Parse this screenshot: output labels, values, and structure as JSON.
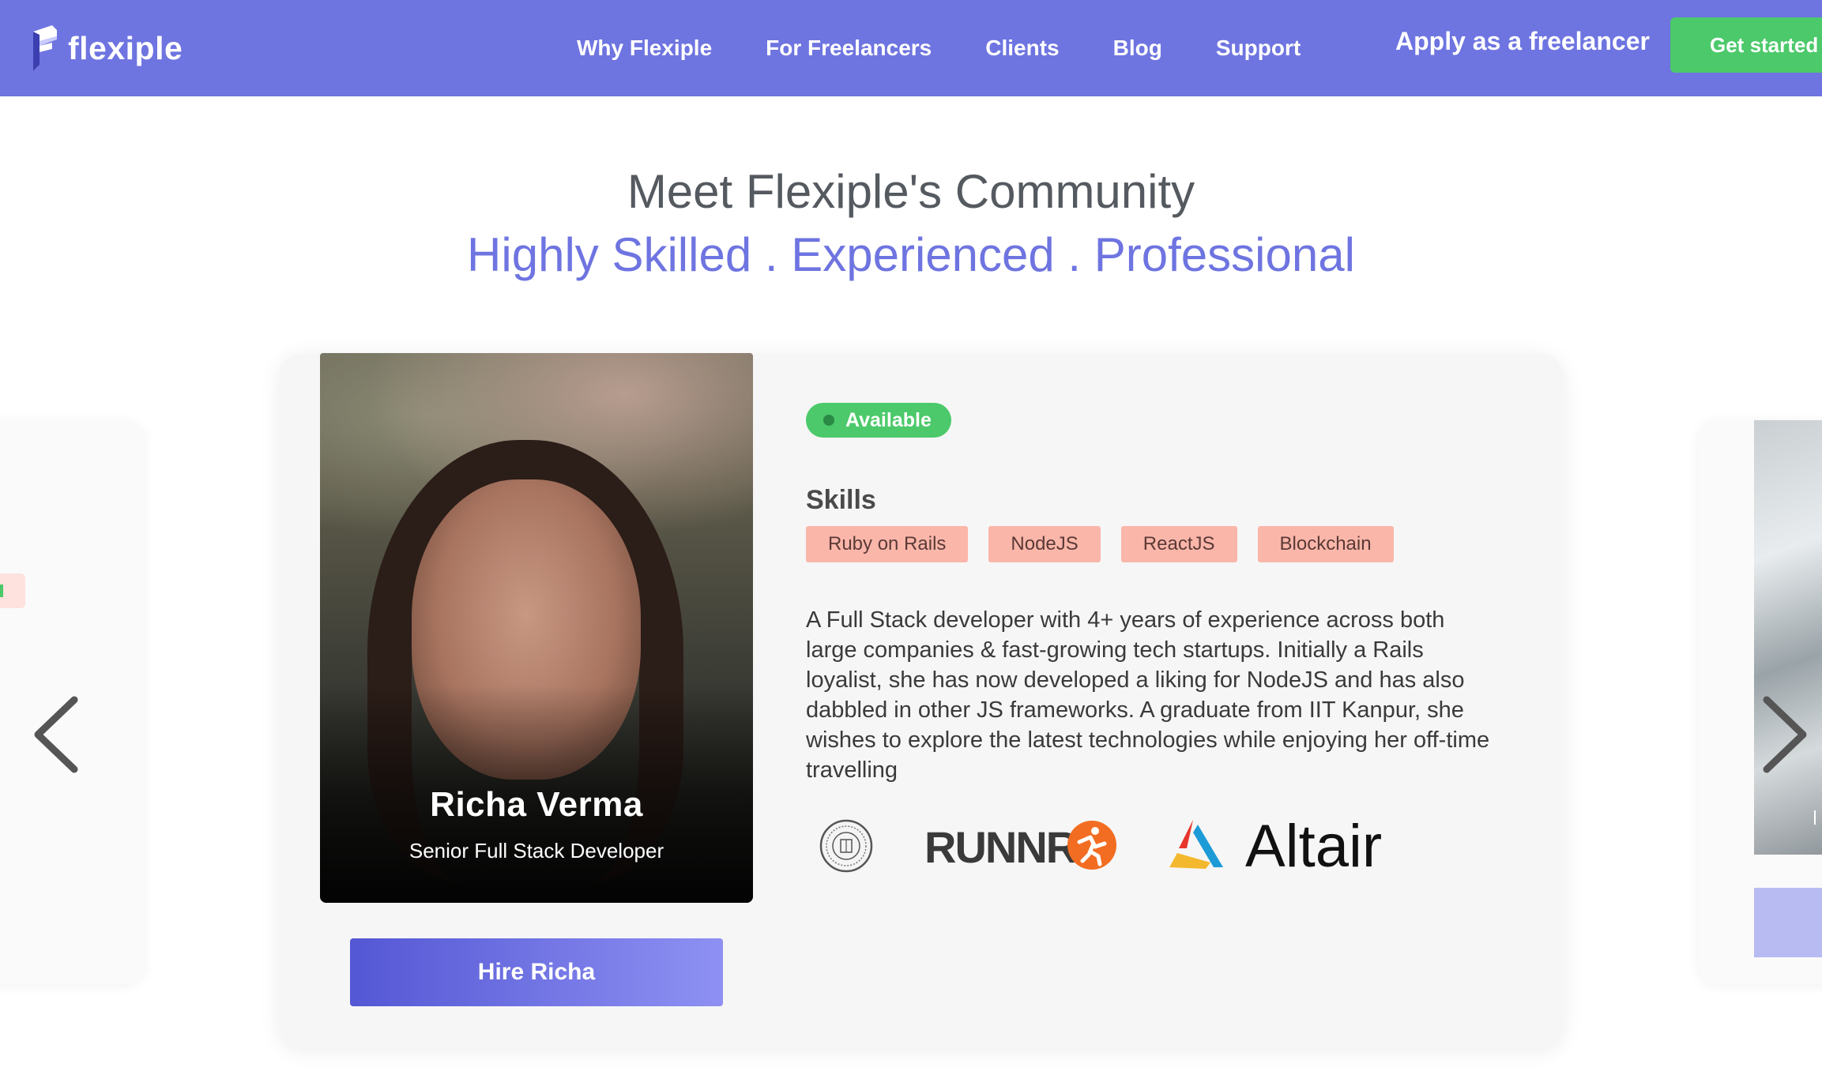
{
  "nav": {
    "brand": "flexiple",
    "links": [
      "Why Flexiple",
      "For Freelancers",
      "Clients",
      "Blog",
      "Support"
    ],
    "apply": "Apply as a freelancer",
    "cta": "Get started"
  },
  "hero": {
    "title": "Meet Flexiple's Community",
    "subtitle": "Highly Skilled . Experienced . Professional"
  },
  "profile": {
    "name": "Richa Verma",
    "role": "Senior Full Stack Developer",
    "status": "Available",
    "skills_title": "Skills",
    "skills": [
      "Ruby on Rails",
      "NodeJS",
      "ReactJS",
      "Blockchain"
    ],
    "bio": "A Full Stack developer with 4+ years of experience across both large companies & fast-growing tech startups. Initially a Rails loyalist, she has now developed a liking for NodeJS and has also dabbled in other JS frameworks. A graduate from IIT Kanpur, she wishes to explore the latest technologies while enjoying her off-time travelling",
    "hire_label": "Hire Richa",
    "logos": {
      "runnr": "RUNNR",
      "altair": "Altair"
    }
  },
  "colors": {
    "nav_bg": "#6e74e0",
    "accent": "#6e74e0",
    "cta": "#4cc96a",
    "skill_bg": "#fbb6aa",
    "runnr_orange": "#f26d22"
  },
  "icons": {
    "prev": "chevron-left-icon",
    "next": "chevron-right-icon"
  }
}
